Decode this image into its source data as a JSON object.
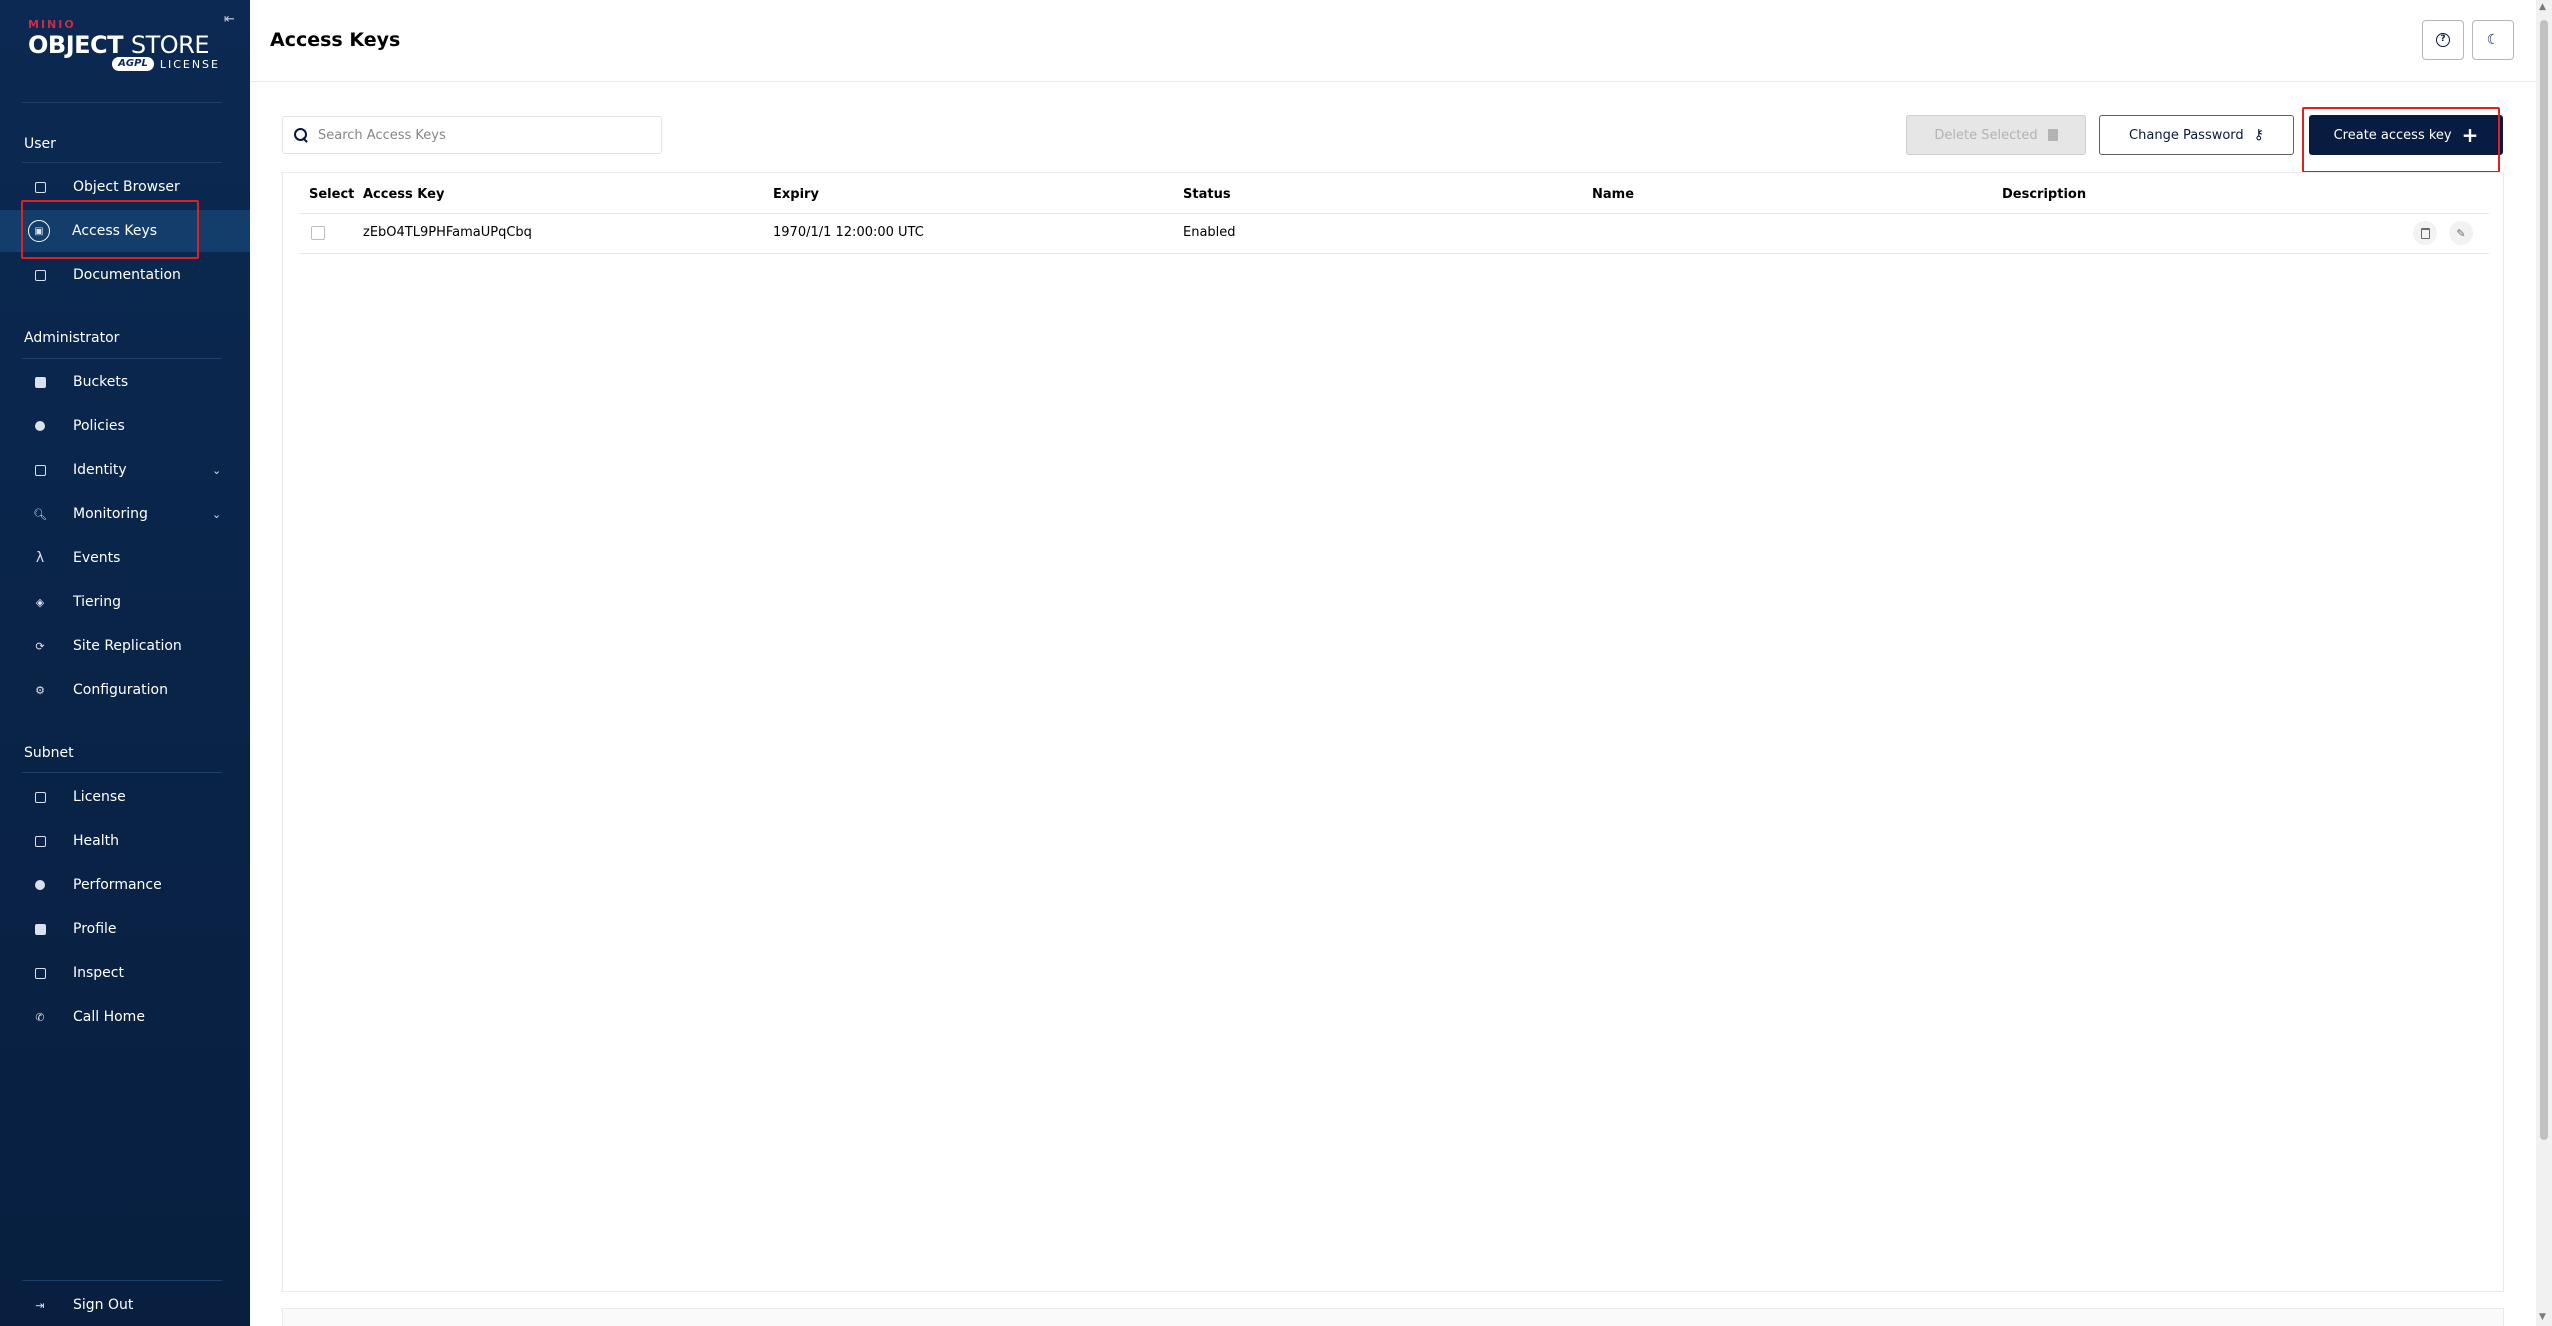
{
  "app": {
    "brand_top": "MINIO",
    "brand_main_bold": "OBJECT",
    "brand_main_light": "STORE",
    "license_badge": "AGPL",
    "license_word": "LICENSE"
  },
  "sidebar": {
    "sections": [
      {
        "label": "User"
      },
      {
        "label": "Administrator"
      },
      {
        "label": "Subnet"
      }
    ],
    "user_items": [
      {
        "label": "Object Browser",
        "icon": "object-browser-icon"
      },
      {
        "label": "Access Keys",
        "icon": "access-keys-icon",
        "active": true
      },
      {
        "label": "Documentation",
        "icon": "documentation-icon"
      }
    ],
    "admin_items": [
      {
        "label": "Buckets",
        "icon": "buckets-icon"
      },
      {
        "label": "Policies",
        "icon": "policies-icon"
      },
      {
        "label": "Identity",
        "icon": "identity-icon",
        "expandable": true
      },
      {
        "label": "Monitoring",
        "icon": "monitoring-icon",
        "expandable": true
      },
      {
        "label": "Events",
        "icon": "lambda-icon"
      },
      {
        "label": "Tiering",
        "icon": "tiering-icon"
      },
      {
        "label": "Site Replication",
        "icon": "replication-icon"
      },
      {
        "label": "Configuration",
        "icon": "gear-icon"
      }
    ],
    "subnet_items": [
      {
        "label": "License",
        "icon": "license-icon"
      },
      {
        "label": "Health",
        "icon": "health-icon"
      },
      {
        "label": "Performance",
        "icon": "performance-icon"
      },
      {
        "label": "Profile",
        "icon": "profile-icon"
      },
      {
        "label": "Inspect",
        "icon": "inspect-icon"
      },
      {
        "label": "Call Home",
        "icon": "call-home-icon"
      }
    ],
    "sign_out": "Sign Out"
  },
  "header": {
    "title": "Access Keys"
  },
  "toolbar": {
    "search_placeholder": "Search Access Keys",
    "delete_selected": "Delete Selected",
    "change_password": "Change Password",
    "create_access_key": "Create access key"
  },
  "table": {
    "columns": [
      "Select",
      "Access Key",
      "Expiry",
      "Status",
      "Name",
      "Description"
    ],
    "rows": [
      {
        "access_key": "zEbO4TL9PHFamaUPqCbq",
        "expiry": "1970/1/1 12:00:00 UTC",
        "status": "Enabled",
        "name": "",
        "description": ""
      }
    ]
  },
  "colors": {
    "sidebar_bg": "#0b2952",
    "sidebar_active": "#133d6a",
    "primary_button": "#081c42",
    "highlight_box": "#e02020",
    "brand_red": "#c72c48"
  }
}
